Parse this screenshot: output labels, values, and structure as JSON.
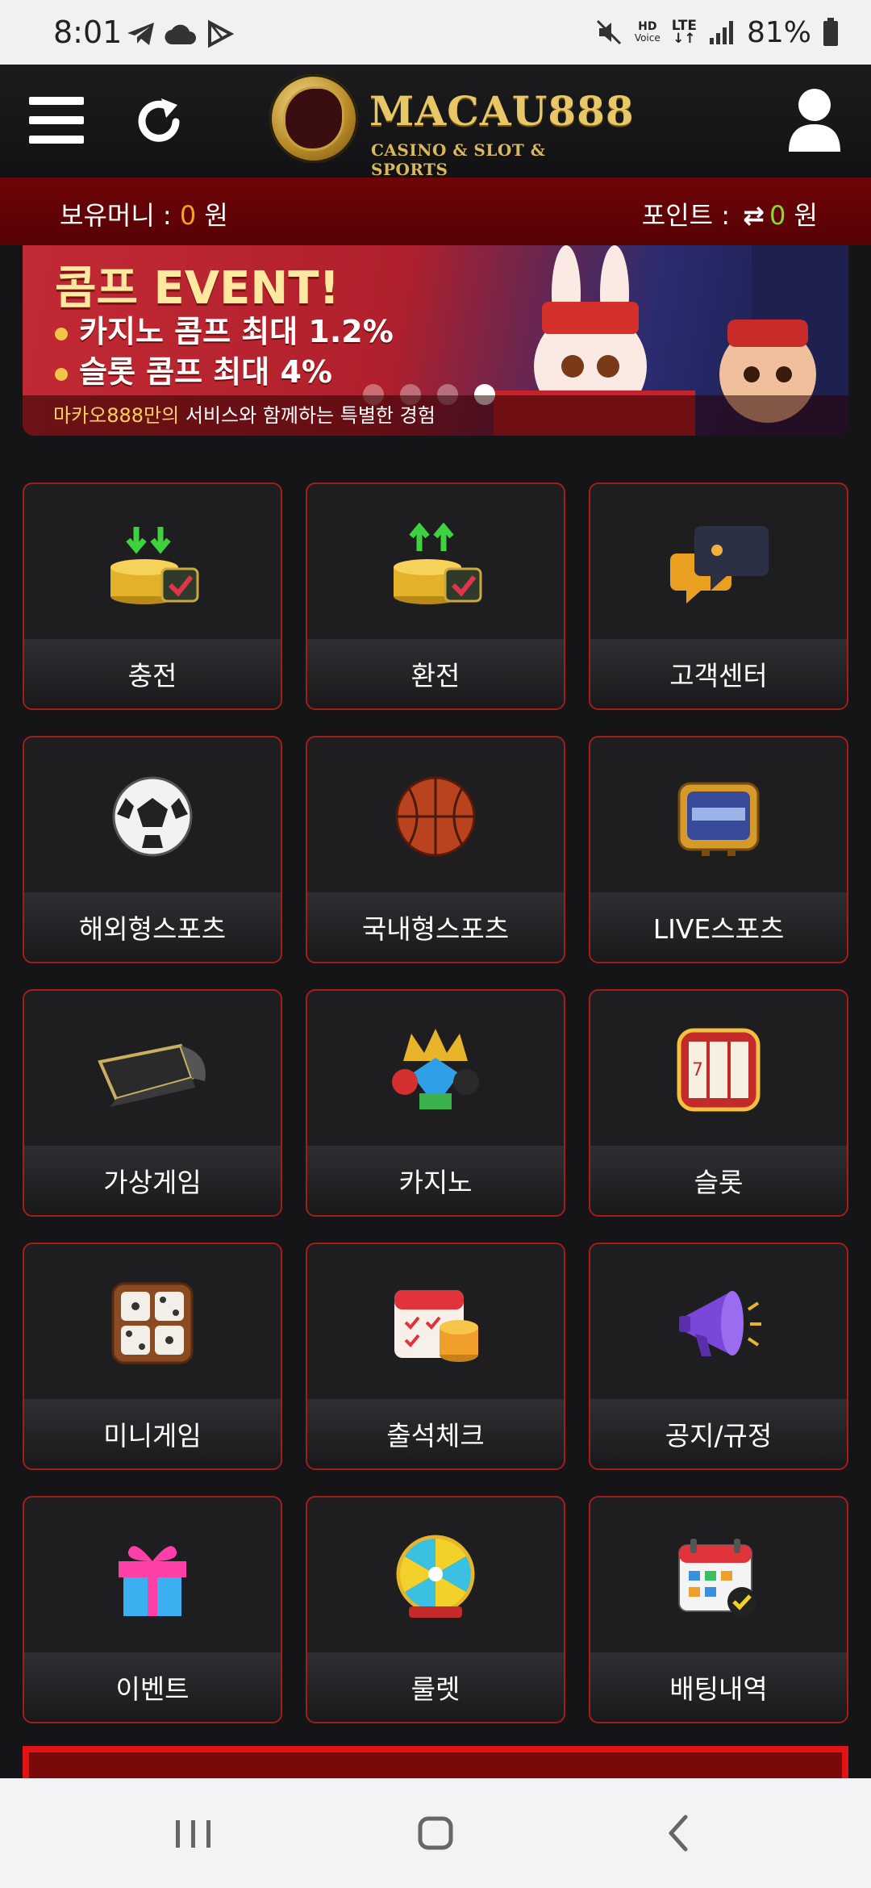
{
  "status_bar": {
    "time": "8:01",
    "left_icons": [
      "telegram-icon",
      "cloud-icon",
      "play-icon"
    ],
    "hd_voice_top": "HD",
    "hd_voice_bottom": "Voice",
    "lte": "LTE",
    "battery": "81%"
  },
  "header": {
    "logo_title": "MACAU888",
    "logo_subtitle": "CASINO & SLOT & SPORTS"
  },
  "wallet": {
    "money_label": "보유머니 : ",
    "money_value": "0",
    "money_unit": " 원",
    "point_label": "포인트 : ",
    "point_icon": "⇄",
    "point_value": "0",
    "point_unit": " 원"
  },
  "banner": {
    "title": "콤프 EVENT!",
    "line1": "카지노 콤프 최대 1.2%",
    "line2": "슬롯 콤프 최대 4%",
    "footer_highlight": "마카오888만의",
    "footer_rest": " 서비스와 함께하는 특별한 경험",
    "active_slide": 4,
    "slide_count": 4
  },
  "menu": [
    {
      "label": "충전",
      "icon": "deposit-coins-icon"
    },
    {
      "label": "환전",
      "icon": "withdraw-coins-icon"
    },
    {
      "label": "고객센터",
      "icon": "chat-bubble-icon"
    },
    {
      "label": "해외형스포츠",
      "icon": "soccer-ball-icon"
    },
    {
      "label": "국내형스포츠",
      "icon": "basketball-icon"
    },
    {
      "label": "LIVE스포츠",
      "icon": "tv-icon"
    },
    {
      "label": "가상게임",
      "icon": "vr-headset-icon"
    },
    {
      "label": "카지노",
      "icon": "casino-crown-icon"
    },
    {
      "label": "슬롯",
      "icon": "slot-machine-icon"
    },
    {
      "label": "미니게임",
      "icon": "dice-icon"
    },
    {
      "label": "출석체크",
      "icon": "calendar-coins-icon"
    },
    {
      "label": "공지/규정",
      "icon": "megaphone-icon"
    },
    {
      "label": "이벤트",
      "icon": "gift-box-icon"
    },
    {
      "label": "룰렛",
      "icon": "roulette-wheel-icon"
    },
    {
      "label": "배팅내역",
      "icon": "calendar-check-icon"
    }
  ],
  "colors": {
    "background": "#151517",
    "tile_border": "#a31d1d",
    "money_bar": "#6e0408",
    "money_value": "#f7a11a",
    "point_value": "#8bd92f"
  }
}
